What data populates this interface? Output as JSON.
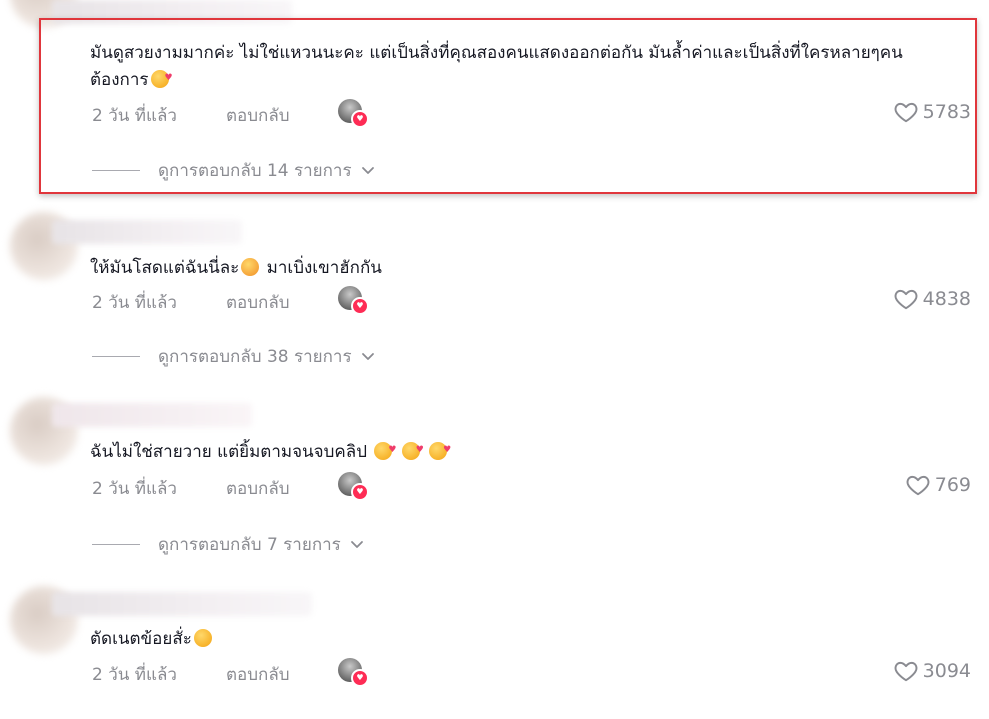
{
  "comments": [
    {
      "text": "มันดูสวยงามมากค่ะ ไม่ใช่แหวนนะคะ แต่เป็นสิ่งที่คุณสองคนแสดงออกต่อกัน มันล้ำค่าและเป็นสิ่งที่ใครหลายๆคนต้องการ",
      "emoji": "smiling-face-with-hearts",
      "time": "2 วัน ที่แล้ว",
      "reply_label": "ตอบกลับ",
      "likes": "5783",
      "view_replies": "ดูการตอบกลับ 14 รายการ"
    },
    {
      "text": "ให้มันโสดแต่ฉันนี่ละ",
      "emoji": "pleading-face",
      "text_after": "มาเบิ่งเขาฮักกัน",
      "time": "2 วัน ที่แล้ว",
      "reply_label": "ตอบกลับ",
      "likes": "4838",
      "view_replies": "ดูการตอบกลับ 38 รายการ"
    },
    {
      "text": "ฉันไม่ใช่สายวาย แต่ยิ้มตามจนจบคลิป",
      "emoji": "smiling-face-with-hearts",
      "time": "2 วัน ที่แล้ว",
      "reply_label": "ตอบกลับ",
      "likes": "769",
      "view_replies": "ดูการตอบกลับ 7 รายการ"
    },
    {
      "text": "ตัดเนตข้อยสั่ะ",
      "emoji": "grinning-sweat-face",
      "time": "2 วัน ที่แล้ว",
      "reply_label": "ตอบกลับ",
      "likes": "3094"
    }
  ],
  "colors": {
    "text": "#161823",
    "secondary": "#8a8b91",
    "highlight_border": "#e0363c",
    "like_badge": "#fe2c55"
  }
}
